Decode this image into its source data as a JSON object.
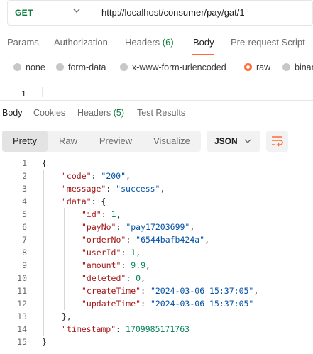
{
  "request": {
    "method": "GET",
    "url": "http://localhost/consumer/pay/gat/1"
  },
  "request_tabs": [
    {
      "label": "Params",
      "count": ""
    },
    {
      "label": "Authorization",
      "count": ""
    },
    {
      "label": "Headers",
      "count": "(6)"
    },
    {
      "label": "Body",
      "count": ""
    },
    {
      "label": "Pre-request Script",
      "count": ""
    }
  ],
  "body_types": [
    "none",
    "form-data",
    "x-www-form-urlencoded",
    "raw",
    "binary"
  ],
  "body_type_selected": "raw",
  "editor_line": "1",
  "response_tabs": [
    {
      "label": "Body",
      "count": ""
    },
    {
      "label": "Cookies",
      "count": ""
    },
    {
      "label": "Headers",
      "count": "(5)"
    },
    {
      "label": "Test Results",
      "count": ""
    }
  ],
  "view_modes": [
    "Pretty",
    "Raw",
    "Preview",
    "Visualize"
  ],
  "view_mode_selected": "Pretty",
  "format": "JSON",
  "response_lines": [
    {
      "num": "1",
      "indent": 0,
      "parts": [
        [
          "p",
          "{"
        ]
      ]
    },
    {
      "num": "2",
      "indent": 1,
      "parts": [
        [
          "k",
          "\"code\""
        ],
        [
          "p",
          ": "
        ],
        [
          "s",
          "\"200\""
        ],
        [
          "p",
          ","
        ]
      ]
    },
    {
      "num": "3",
      "indent": 1,
      "parts": [
        [
          "k",
          "\"message\""
        ],
        [
          "p",
          ": "
        ],
        [
          "s",
          "\"success\""
        ],
        [
          "p",
          ","
        ]
      ]
    },
    {
      "num": "4",
      "indent": 1,
      "parts": [
        [
          "k",
          "\"data\""
        ],
        [
          "p",
          ": {"
        ]
      ]
    },
    {
      "num": "5",
      "indent": 2,
      "parts": [
        [
          "k",
          "\"id\""
        ],
        [
          "p",
          ": "
        ],
        [
          "n",
          "1"
        ],
        [
          "p",
          ","
        ]
      ]
    },
    {
      "num": "6",
      "indent": 2,
      "parts": [
        [
          "k",
          "\"payNo\""
        ],
        [
          "p",
          ": "
        ],
        [
          "s",
          "\"pay17203699\""
        ],
        [
          "p",
          ","
        ]
      ]
    },
    {
      "num": "7",
      "indent": 2,
      "parts": [
        [
          "k",
          "\"orderNo\""
        ],
        [
          "p",
          ": "
        ],
        [
          "s",
          "\"6544bafb424a\""
        ],
        [
          "p",
          ","
        ]
      ]
    },
    {
      "num": "8",
      "indent": 2,
      "parts": [
        [
          "k",
          "\"userId\""
        ],
        [
          "p",
          ": "
        ],
        [
          "n",
          "1"
        ],
        [
          "p",
          ","
        ]
      ]
    },
    {
      "num": "9",
      "indent": 2,
      "parts": [
        [
          "k",
          "\"amount\""
        ],
        [
          "p",
          ": "
        ],
        [
          "n",
          "9.9"
        ],
        [
          "p",
          ","
        ]
      ]
    },
    {
      "num": "10",
      "indent": 2,
      "parts": [
        [
          "k",
          "\"deleted\""
        ],
        [
          "p",
          ": "
        ],
        [
          "n",
          "0"
        ],
        [
          "p",
          ","
        ]
      ]
    },
    {
      "num": "11",
      "indent": 2,
      "parts": [
        [
          "k",
          "\"createTime\""
        ],
        [
          "p",
          ": "
        ],
        [
          "s",
          "\"2024-03-06 15:37:05\""
        ],
        [
          "p",
          ","
        ]
      ]
    },
    {
      "num": "12",
      "indent": 2,
      "parts": [
        [
          "k",
          "\"updateTime\""
        ],
        [
          "p",
          ": "
        ],
        [
          "s",
          "\"2024-03-06 15:37:05\""
        ]
      ]
    },
    {
      "num": "13",
      "indent": 1,
      "parts": [
        [
          "p",
          "},"
        ]
      ]
    },
    {
      "num": "14",
      "indent": 1,
      "parts": [
        [
          "k",
          "\"timestamp\""
        ],
        [
          "p",
          ": "
        ],
        [
          "n",
          "1709985171763"
        ]
      ]
    },
    {
      "num": "15",
      "indent": 0,
      "parts": [
        [
          "p",
          "}"
        ]
      ]
    }
  ],
  "icons": {
    "method_dropdown": "chevron-down-icon",
    "format_dropdown": "chevron-down-icon",
    "wrap": "wrap-lines-icon"
  },
  "colors": {
    "accent": "#ff6c37",
    "method_get": "#0b7a3e",
    "json_key": "#a31515",
    "json_string": "#0451a5",
    "json_number": "#098658"
  }
}
